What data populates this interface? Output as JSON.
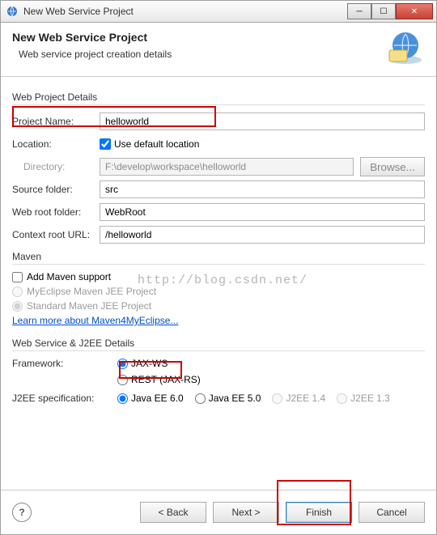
{
  "window": {
    "title": "New Web Service Project"
  },
  "header": {
    "title": "New Web Service Project",
    "subtitle": "Web service project creation details"
  },
  "groups": {
    "details": "Web Project Details",
    "maven": "Maven",
    "ws": "Web Service & J2EE Details"
  },
  "fields": {
    "project_name_label": "Project Name:",
    "project_name_value": "helloworld",
    "location_label": "Location:",
    "use_default_label": "Use default location",
    "directory_label": "Directory:",
    "directory_value": "F:\\develop\\workspace\\helloworld",
    "browse_label": "Browse...",
    "source_folder_label": "Source folder:",
    "source_folder_value": "src",
    "web_root_label": "Web root folder:",
    "web_root_value": "WebRoot",
    "context_url_label": "Context root URL:",
    "context_url_value": "/helloworld"
  },
  "maven": {
    "add_support": "Add Maven support",
    "myeclipse": "MyEclipse Maven JEE Project",
    "standard": "Standard Maven JEE Project",
    "learn": "Learn more about Maven4MyEclipse..."
  },
  "ws": {
    "framework_label": "Framework:",
    "jaxws": "JAX-WS",
    "rest": "REST (JAX-RS)",
    "j2ee_label": "J2EE specification:",
    "jee6": "Java EE 6.0",
    "jee5": "Java EE 5.0",
    "j2ee14": "J2EE 1.4",
    "j2ee13": "J2EE 1.3"
  },
  "footer": {
    "back": "< Back",
    "next": "Next >",
    "finish": "Finish",
    "cancel": "Cancel",
    "help": "?"
  },
  "watermark": "http://blog.csdn.net/"
}
